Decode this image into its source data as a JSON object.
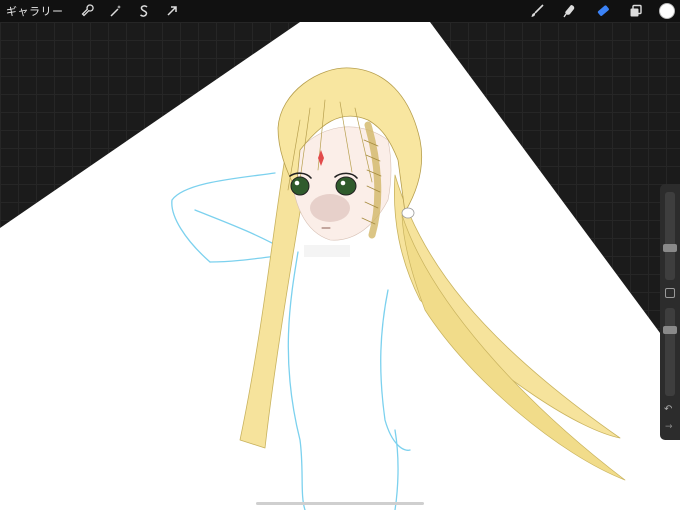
{
  "topbar": {
    "gallery_label": "ギャラリー",
    "left_tools": [
      "wrench-icon",
      "magic-wand-icon",
      "selection-s-icon",
      "move-arrow-icon"
    ],
    "right_tools": [
      "brush-icon",
      "smudge-icon",
      "eraser-icon",
      "layers-icon"
    ],
    "active_tool": "eraser-icon",
    "current_color": "#ffffff",
    "accent_color": "#3b82f6"
  },
  "sidebar": {
    "brush_size": 0.35,
    "opacity": 0.78,
    "undo_symbol": "↶",
    "redo_symbol": "→"
  }
}
